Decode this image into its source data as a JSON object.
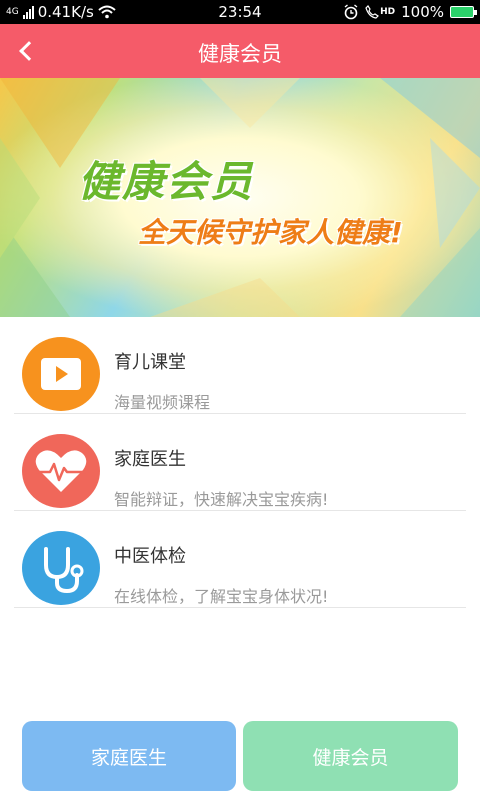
{
  "status_bar": {
    "network": "4G",
    "speed": "0.41K/s",
    "time": "23:54",
    "hd_label": "HD",
    "battery": "100%"
  },
  "header": {
    "title": "健康会员"
  },
  "banner": {
    "title": "健康会员",
    "subtitle": "全天候守护家人健康!"
  },
  "list": {
    "items": [
      {
        "title": "育儿课堂",
        "subtitle": "海量视频课程",
        "icon": "video-play-icon",
        "color": "#f7921e"
      },
      {
        "title": "家庭医生",
        "subtitle": "智能辩证，快速解决宝宝疾病!",
        "icon": "heart-pulse-icon",
        "color": "#f0675a"
      },
      {
        "title": "中医体检",
        "subtitle": "在线体检，了解宝宝身体状况!",
        "icon": "stethoscope-icon",
        "color": "#3aa3e0"
      }
    ]
  },
  "bottom_buttons": {
    "doctor_label": "家庭医生",
    "member_label": "健康会员"
  },
  "colors": {
    "header": "#f55b69",
    "btn_doctor": "#7dbaf2",
    "btn_member": "#8fe0b3"
  }
}
